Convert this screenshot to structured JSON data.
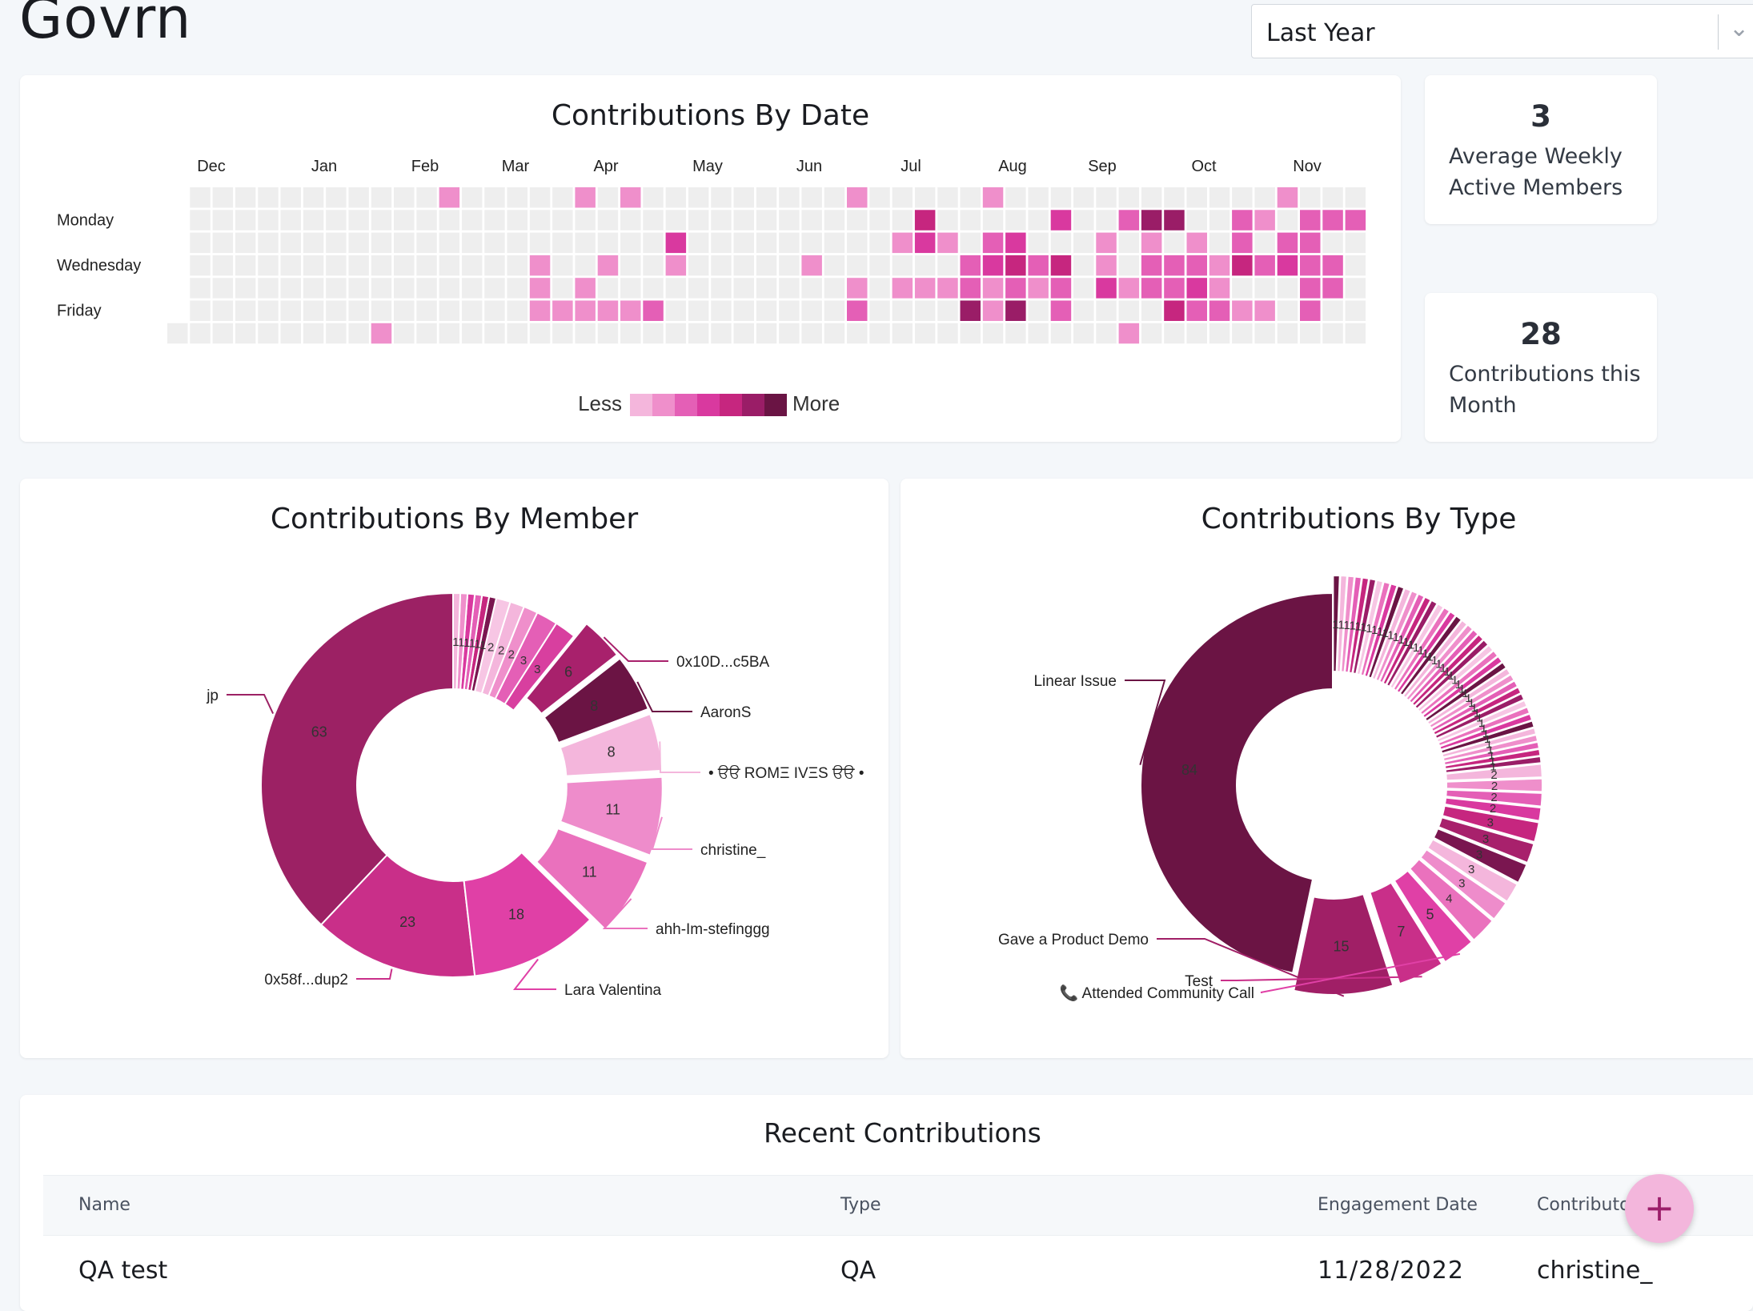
{
  "app": {
    "title": "Govrn"
  },
  "period_select": {
    "value": "Last Year"
  },
  "heatmap": {
    "title": "Contributions By Date",
    "months": [
      "Dec",
      "Jan",
      "Feb",
      "Mar",
      "Apr",
      "May",
      "Jun",
      "Jul",
      "Aug",
      "Sep",
      "Oct",
      "Nov"
    ],
    "day_labels": [
      "Monday",
      "Wednesday",
      "Friday"
    ],
    "legend": {
      "less": "Less",
      "more": "More"
    },
    "colors": [
      "#eeeeee",
      "#f4b6dc",
      "#ef8fcb",
      "#e45fb6",
      "#d9399f",
      "#c6267f",
      "#9a1d67",
      "#6a1444"
    ],
    "weeks": [
      [
        null,
        null,
        null,
        null,
        null,
        null,
        0
      ],
      [
        0,
        0,
        0,
        0,
        0,
        0,
        0
      ],
      [
        0,
        0,
        0,
        0,
        0,
        0,
        0
      ],
      [
        0,
        0,
        0,
        0,
        0,
        0,
        0
      ],
      [
        0,
        0,
        0,
        0,
        0,
        0,
        0
      ],
      [
        0,
        0,
        0,
        0,
        0,
        0,
        0
      ],
      [
        0,
        0,
        0,
        0,
        0,
        0,
        0
      ],
      [
        0,
        0,
        0,
        0,
        0,
        0,
        0
      ],
      [
        0,
        0,
        0,
        0,
        0,
        0,
        0
      ],
      [
        0,
        0,
        0,
        0,
        0,
        0,
        2
      ],
      [
        0,
        0,
        0,
        0,
        0,
        0,
        0
      ],
      [
        0,
        0,
        0,
        0,
        0,
        0,
        0
      ],
      [
        2,
        0,
        0,
        0,
        0,
        0,
        0
      ],
      [
        0,
        0,
        0,
        0,
        0,
        0,
        0
      ],
      [
        0,
        0,
        0,
        0,
        0,
        0,
        0
      ],
      [
        0,
        0,
        0,
        0,
        0,
        0,
        0
      ],
      [
        0,
        0,
        0,
        2,
        2,
        2,
        0
      ],
      [
        0,
        0,
        0,
        0,
        0,
        2,
        0
      ],
      [
        2,
        0,
        0,
        0,
        2,
        2,
        0
      ],
      [
        0,
        0,
        0,
        2,
        0,
        2,
        0
      ],
      [
        2,
        0,
        0,
        0,
        0,
        2,
        0
      ],
      [
        0,
        0,
        0,
        0,
        0,
        3,
        0
      ],
      [
        0,
        0,
        4,
        2,
        0,
        0,
        0
      ],
      [
        0,
        0,
        0,
        0,
        0,
        0,
        0
      ],
      [
        0,
        0,
        0,
        0,
        0,
        0,
        0
      ],
      [
        0,
        0,
        0,
        0,
        0,
        0,
        0
      ],
      [
        0,
        0,
        0,
        0,
        0,
        0,
        0
      ],
      [
        0,
        0,
        0,
        0,
        0,
        0,
        0
      ],
      [
        0,
        0,
        0,
        2,
        0,
        0,
        0
      ],
      [
        0,
        0,
        0,
        0,
        0,
        0,
        0
      ],
      [
        2,
        0,
        0,
        0,
        2,
        3,
        0
      ],
      [
        0,
        0,
        0,
        0,
        0,
        0,
        0
      ],
      [
        0,
        0,
        2,
        0,
        2,
        0,
        0
      ],
      [
        0,
        5,
        4,
        0,
        2,
        0,
        0
      ],
      [
        0,
        0,
        2,
        0,
        2,
        0,
        0
      ],
      [
        0,
        0,
        0,
        3,
        3,
        6,
        0
      ],
      [
        2,
        0,
        3,
        4,
        2,
        2,
        0
      ],
      [
        0,
        0,
        4,
        5,
        3,
        6,
        0
      ],
      [
        0,
        0,
        0,
        3,
        2,
        0,
        0
      ],
      [
        0,
        4,
        0,
        5,
        3,
        3,
        0
      ],
      [
        0,
        0,
        0,
        0,
        0,
        0,
        0
      ],
      [
        0,
        0,
        2,
        2,
        4,
        0,
        0
      ],
      [
        0,
        3,
        0,
        0,
        2,
        0,
        2
      ],
      [
        0,
        6,
        2,
        3,
        3,
        0,
        0
      ],
      [
        0,
        6,
        0,
        3,
        3,
        5,
        0
      ],
      [
        0,
        0,
        2,
        3,
        4,
        3,
        0
      ],
      [
        0,
        0,
        0,
        2,
        2,
        3,
        0
      ],
      [
        0,
        3,
        3,
        5,
        0,
        2,
        0
      ],
      [
        0,
        2,
        0,
        3,
        0,
        2,
        0
      ],
      [
        2,
        0,
        3,
        4,
        0,
        0,
        0
      ],
      [
        0,
        3,
        3,
        3,
        3,
        3,
        0
      ],
      [
        0,
        3,
        0,
        3,
        3,
        0,
        0
      ],
      [
        0,
        3,
        0,
        0,
        0,
        0,
        0
      ]
    ]
  },
  "stats": {
    "weekly_value": "3",
    "weekly_label_line1": "Average Weekly",
    "weekly_label_line2": "Active Members",
    "month_value": "28",
    "month_label_line1": "Contributions this",
    "month_label_line2": "Month"
  },
  "member_chart": {
    "title": "Contributions By Member",
    "chart_data": {
      "type": "pie",
      "title": "Contributions By Member",
      "slices": [
        {
          "label": "jp",
          "value": 63,
          "color": "#9c2164"
        },
        {
          "label": "0x58f...dup2",
          "value": 23,
          "color": "#c92f89"
        },
        {
          "label": "Lara Valentina",
          "value": 18,
          "color": "#e040a6"
        },
        {
          "label": "ahh-Im-stefinggg",
          "value": 11,
          "color": "#ea71bd"
        },
        {
          "label": "christine_",
          "value": 11,
          "color": "#ee8ccb"
        },
        {
          "label": "• ੳੳ ROMΞ IVΞS ੳੳ •",
          "value": 8,
          "color": "#f4b6dc"
        },
        {
          "label": "AaronS",
          "value": 8,
          "color": "#6b1444"
        },
        {
          "label": "0x10D...c5BA",
          "value": 6,
          "color": "#a8216c"
        },
        {
          "label": "",
          "value": 3,
          "color": "#d83f9f"
        },
        {
          "label": "",
          "value": 3,
          "color": "#e45fb6"
        },
        {
          "label": "",
          "value": 2,
          "color": "#ef8fcb"
        },
        {
          "label": "",
          "value": 2,
          "color": "#f4b6dc"
        },
        {
          "label": "",
          "value": 2,
          "color": "#f7c6e4"
        },
        {
          "label": "",
          "value": 1,
          "color": "#7a1650"
        },
        {
          "label": "",
          "value": 1,
          "color": "#c6267f"
        },
        {
          "label": "",
          "value": 1,
          "color": "#e45fb6"
        },
        {
          "label": "",
          "value": 1,
          "color": "#d9399f"
        },
        {
          "label": "",
          "value": 1,
          "color": "#ef8fcb"
        },
        {
          "label": "",
          "value": 1,
          "color": "#f4b6dc"
        }
      ]
    }
  },
  "type_chart": {
    "title": "Contributions By Type",
    "chart_data": {
      "type": "pie",
      "title": "Contributions By Type",
      "slices": [
        {
          "label": "Linear Issue",
          "value": 84,
          "color": "#6b1444"
        },
        {
          "label": "Gave a Product Demo",
          "value": 15,
          "color": "#a01f66"
        },
        {
          "label": "Test",
          "value": 7,
          "color": "#c92f89"
        },
        {
          "label": "📞 Attended Community Call",
          "value": 5,
          "color": "#e040a6"
        },
        {
          "label": "",
          "value": 4,
          "color": "#ea71bd"
        },
        {
          "label": "",
          "value": 3,
          "color": "#ee8ccb"
        },
        {
          "label": "",
          "value": 3,
          "color": "#f4b6dc"
        },
        {
          "label": "",
          "value": 3,
          "color": "#7a1650"
        },
        {
          "label": "",
          "value": 3,
          "color": "#a8216c"
        },
        {
          "label": "",
          "value": 3,
          "color": "#c6267f"
        },
        {
          "label": "",
          "value": 2,
          "color": "#d9399f"
        },
        {
          "label": "",
          "value": 2,
          "color": "#e45fb6"
        },
        {
          "label": "",
          "value": 2,
          "color": "#ef8fcb"
        },
        {
          "label": "",
          "value": 2,
          "color": "#f4b6dc"
        },
        {
          "label": "",
          "value": 1,
          "color": "#9a1d67"
        },
        {
          "label": "",
          "value": 1,
          "color": "#c6267f"
        },
        {
          "label": "",
          "value": 1,
          "color": "#e45fb6"
        },
        {
          "label": "",
          "value": 1,
          "color": "#ef8fcb"
        },
        {
          "label": "",
          "value": 1,
          "color": "#f4b6dc"
        },
        {
          "label": "",
          "value": 1,
          "color": "#6a1444"
        },
        {
          "label": "",
          "value": 1,
          "color": "#d9399f"
        },
        {
          "label": "",
          "value": 1,
          "color": "#ea71bd"
        },
        {
          "label": "",
          "value": 1,
          "color": "#f7c6e4"
        },
        {
          "label": "",
          "value": 1,
          "color": "#9a1d67"
        },
        {
          "label": "",
          "value": 1,
          "color": "#c6267f"
        },
        {
          "label": "",
          "value": 1,
          "color": "#e45fb6"
        },
        {
          "label": "",
          "value": 1,
          "color": "#ef8fcb"
        },
        {
          "label": "",
          "value": 1,
          "color": "#f4b6dc"
        },
        {
          "label": "",
          "value": 1,
          "color": "#6a1444"
        },
        {
          "label": "",
          "value": 1,
          "color": "#d9399f"
        },
        {
          "label": "",
          "value": 1,
          "color": "#ea71bd"
        },
        {
          "label": "",
          "value": 1,
          "color": "#f7c6e4"
        },
        {
          "label": "",
          "value": 1,
          "color": "#9a1d67"
        },
        {
          "label": "",
          "value": 1,
          "color": "#c6267f"
        },
        {
          "label": "",
          "value": 1,
          "color": "#e45fb6"
        },
        {
          "label": "",
          "value": 1,
          "color": "#ef8fcb"
        },
        {
          "label": "",
          "value": 1,
          "color": "#f4b6dc"
        },
        {
          "label": "",
          "value": 1,
          "color": "#6a1444"
        },
        {
          "label": "",
          "value": 1,
          "color": "#d9399f"
        },
        {
          "label": "",
          "value": 1,
          "color": "#ea71bd"
        },
        {
          "label": "",
          "value": 1,
          "color": "#f7c6e4"
        },
        {
          "label": "",
          "value": 1,
          "color": "#9a1d67"
        },
        {
          "label": "",
          "value": 1,
          "color": "#c6267f"
        },
        {
          "label": "",
          "value": 1,
          "color": "#e45fb6"
        },
        {
          "label": "",
          "value": 1,
          "color": "#ef8fcb"
        },
        {
          "label": "",
          "value": 1,
          "color": "#f4b6dc"
        },
        {
          "label": "",
          "value": 1,
          "color": "#6a1444"
        },
        {
          "label": "",
          "value": 1,
          "color": "#d9399f"
        },
        {
          "label": "",
          "value": 1,
          "color": "#ea71bd"
        },
        {
          "label": "",
          "value": 1,
          "color": "#f7c6e4"
        },
        {
          "label": "",
          "value": 1,
          "color": "#9a1d67"
        },
        {
          "label": "",
          "value": 1,
          "color": "#c6267f"
        },
        {
          "label": "",
          "value": 1,
          "color": "#e45fb6"
        },
        {
          "label": "",
          "value": 1,
          "color": "#ef8fcb"
        },
        {
          "label": "",
          "value": 1,
          "color": "#f4b6dc"
        },
        {
          "label": "",
          "value": 1,
          "color": "#6a1444"
        }
      ]
    }
  },
  "recent": {
    "title": "Recent Contributions",
    "columns": {
      "name": "Name",
      "type": "Type",
      "date": "Engagement Date",
      "contributor": "Contributor"
    },
    "rows": [
      {
        "name": "QA test",
        "type": "QA",
        "date": "11/28/2022",
        "contributor": "christine_"
      }
    ]
  },
  "fab": {
    "label": "+"
  }
}
